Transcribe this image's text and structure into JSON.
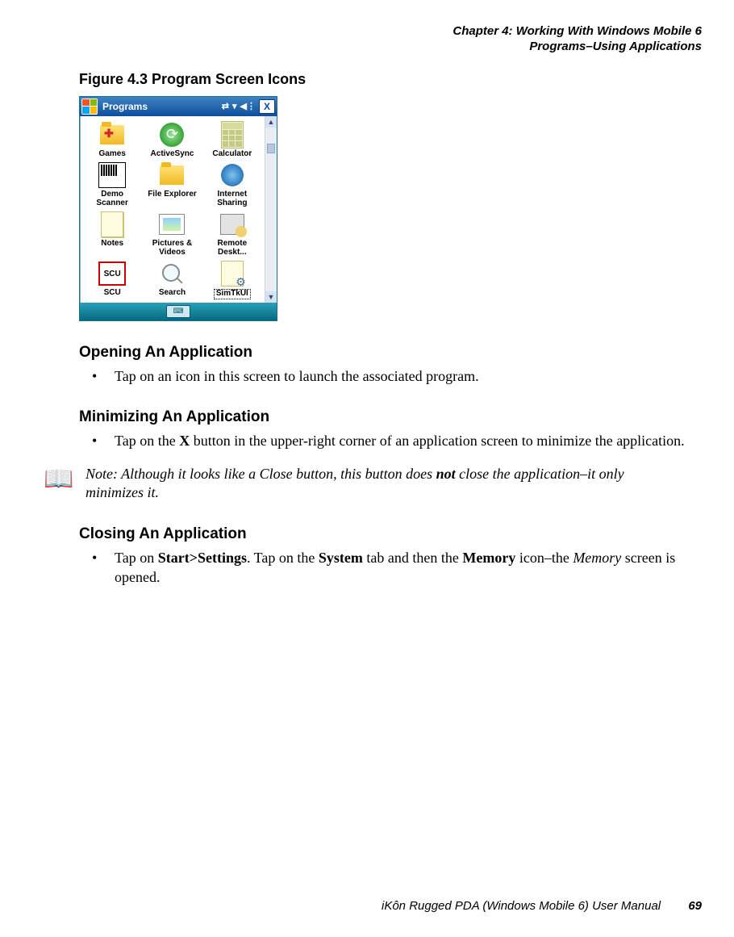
{
  "header": {
    "line1": "Chapter 4: Working With Windows Mobile 6",
    "line2": "Programs–Using Applications"
  },
  "figure": {
    "caption": "Figure 4.3  Program Screen Icons"
  },
  "screenshot": {
    "title": "Programs",
    "status_icons": [
      "sync-icon",
      "signal-icon",
      "volume-icon"
    ],
    "close_label": "X",
    "apps": [
      {
        "id": "games",
        "label": "Games"
      },
      {
        "id": "activesync",
        "label": "ActiveSync"
      },
      {
        "id": "calculator",
        "label": "Calculator"
      },
      {
        "id": "demoscanner",
        "label": "Demo\nScanner"
      },
      {
        "id": "fileexplorer",
        "label": "File Explorer"
      },
      {
        "id": "internetsharing",
        "label": "Internet\nSharing"
      },
      {
        "id": "notes",
        "label": "Notes"
      },
      {
        "id": "picturesvideos",
        "label": "Pictures &\nVideos"
      },
      {
        "id": "remotedesktop",
        "label": "Remote\nDeskt..."
      },
      {
        "id": "scu",
        "label": "SCU"
      },
      {
        "id": "search",
        "label": "Search"
      },
      {
        "id": "simtkui",
        "label": "SimTkUI",
        "selected": true
      }
    ],
    "scu_text": "SCU"
  },
  "sections": {
    "opening": {
      "heading": "Opening An Application",
      "bullet": "Tap on an icon in this screen to launch the associated program."
    },
    "minimizing": {
      "heading": "Minimizing An Application",
      "bullet_pre": "Tap on the ",
      "bullet_bold": "X",
      "bullet_post": " button in the upper-right corner of an application screen to minimize the application."
    },
    "note": {
      "label": "Note: ",
      "pre": "Although it looks like a Close button, this button does ",
      "bold": "not",
      "post": " close the application–it only minimizes it."
    },
    "closing": {
      "heading": "Closing An Application",
      "bullet_pre": "Tap on ",
      "b1": "Start>Settings",
      "mid1": ". Tap on the ",
      "b2": "System",
      "mid2": " tab and then the ",
      "b3": "Memory",
      "mid3": " icon–the ",
      "i1": "Memory",
      "post": " screen is opened."
    }
  },
  "footer": {
    "text": "iKôn Rugged PDA (Windows Mobile 6) User Manual",
    "page": "69"
  }
}
